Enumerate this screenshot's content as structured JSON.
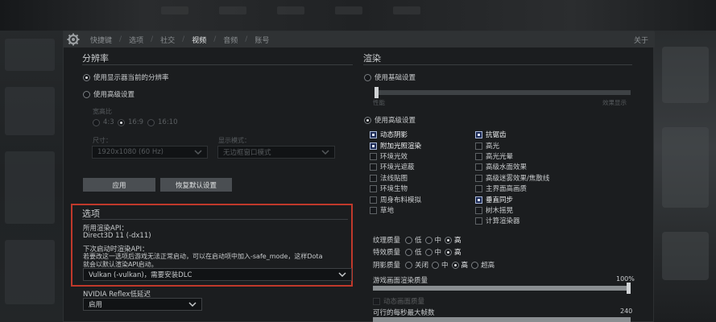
{
  "tabs": [
    {
      "label": "快捷键",
      "active": false
    },
    {
      "label": "选项",
      "active": false
    },
    {
      "label": "社交",
      "active": false
    },
    {
      "label": "视频",
      "active": true
    },
    {
      "label": "音频",
      "active": false
    },
    {
      "label": "账号",
      "active": false
    }
  ],
  "about_label": "关于",
  "resolution": {
    "title": "分辨率",
    "use_current_label": "使用显示器当前的分辨率",
    "use_advanced_label": "使用高级设置",
    "aspect_label": "宽高比",
    "aspect_options": [
      "4:3",
      "16:9",
      "16:10"
    ],
    "size_label": "尺寸：",
    "size_value": "1920x1080 (60 Hz)",
    "display_mode_label": "显示模式：",
    "display_mode_value": "无边框窗口模式",
    "apply_label": "应用",
    "restore_label": "恢复默认设置"
  },
  "options": {
    "title": "选项",
    "render_api_label": "所用渲染API：",
    "render_api_value": "Direct3D 11 (-dx11)",
    "next_launch_label": "下次启动时渲染API：",
    "warning_line1": "若要改这一选项后游戏无法正常启动，可以在启动项中加入-safe_mode，这样Dota",
    "warning_line2": "就会以默认渲染API启动。",
    "api_select_value": "Vulkan (-vulkan)，需要安装DLC",
    "reflex_label": "NVIDIA Reflex低延迟",
    "reflex_value": "启用"
  },
  "render": {
    "title": "渲染",
    "use_basic_label": "使用基础设置",
    "basic_slider_left": "性能",
    "basic_slider_right": "效果显示",
    "use_advanced_label": "使用高级设置",
    "left_checks": [
      {
        "label": "动态阴影",
        "checked": true
      },
      {
        "label": "附加光照渲染",
        "checked": true
      },
      {
        "label": "环境光效",
        "checked": false
      },
      {
        "label": "环境光遮蔽",
        "checked": false
      },
      {
        "label": "法线贴图",
        "checked": false
      },
      {
        "label": "环境生物",
        "checked": false
      },
      {
        "label": "周身布料模拟",
        "checked": false
      },
      {
        "label": "草地",
        "checked": false
      }
    ],
    "right_checks": [
      {
        "label": "抗锯齿",
        "checked": true
      },
      {
        "label": "高光",
        "checked": false
      },
      {
        "label": "高光光晕",
        "checked": false
      },
      {
        "label": "高级水面效果",
        "checked": false
      },
      {
        "label": "高级迷雾效果/焦散线",
        "checked": false
      },
      {
        "label": "主界面高画质",
        "checked": false
      },
      {
        "label": "垂直同步",
        "checked": true
      },
      {
        "label": "树木摇晃",
        "checked": false
      },
      {
        "label": "计算渲染器",
        "checked": false
      }
    ],
    "texture_label": "纹理质量",
    "effects_label": "特效质量",
    "shadow_label": "阴影质量",
    "low": "低",
    "mid": "中",
    "high": "高",
    "off": "关闭",
    "ultra": "超高",
    "texture_selected": "高",
    "effects_selected": "高",
    "shadow_selected": "高",
    "screen_quality_label": "游戏画面渲染质量",
    "screen_quality_value": "100%",
    "screen_quality_fraction": 1.0,
    "dynamic_label": "动态画面质量",
    "fps_label": "可行的每秒最大帧数",
    "fps_value": "240"
  }
}
